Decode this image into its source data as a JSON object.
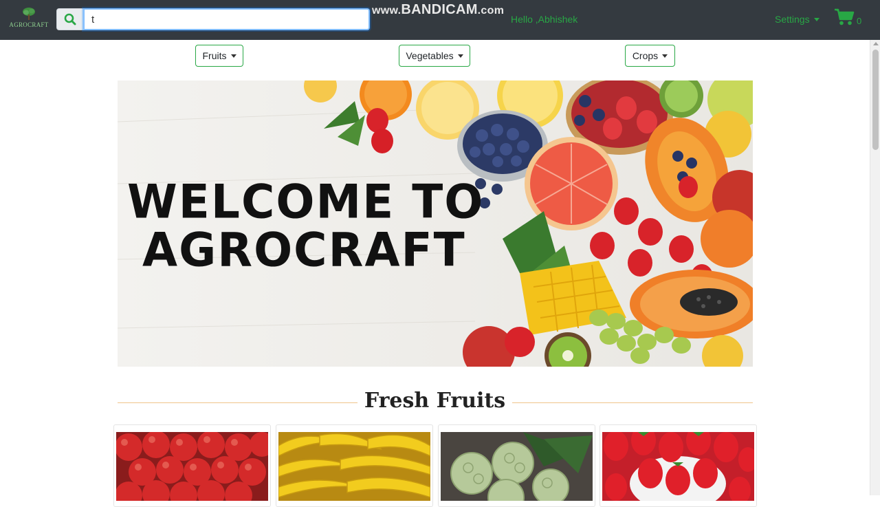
{
  "brand": {
    "logo_text": "AGROCRAFT"
  },
  "search": {
    "value": "t"
  },
  "watermark": {
    "prefix": "www.",
    "name": "BANDICAM",
    "suffix": ".com"
  },
  "user": {
    "greeting": "Hello ,Abhishek"
  },
  "settings": {
    "label": "Settings"
  },
  "cart": {
    "count": "0"
  },
  "categories": [
    {
      "label": "Fruits"
    },
    {
      "label": "Vegetables"
    },
    {
      "label": "Crops"
    }
  ],
  "banner": {
    "line1": "WELCOME TO",
    "line2": "AGROCRAFT"
  },
  "section": {
    "title": "Fresh Fruits"
  },
  "products": [
    {
      "name": "apples"
    },
    {
      "name": "bananas"
    },
    {
      "name": "custard-apples"
    },
    {
      "name": "strawberries"
    }
  ],
  "colors": {
    "navbar": "#343a40",
    "accent": "#28a745",
    "focus": "#80bdff"
  }
}
